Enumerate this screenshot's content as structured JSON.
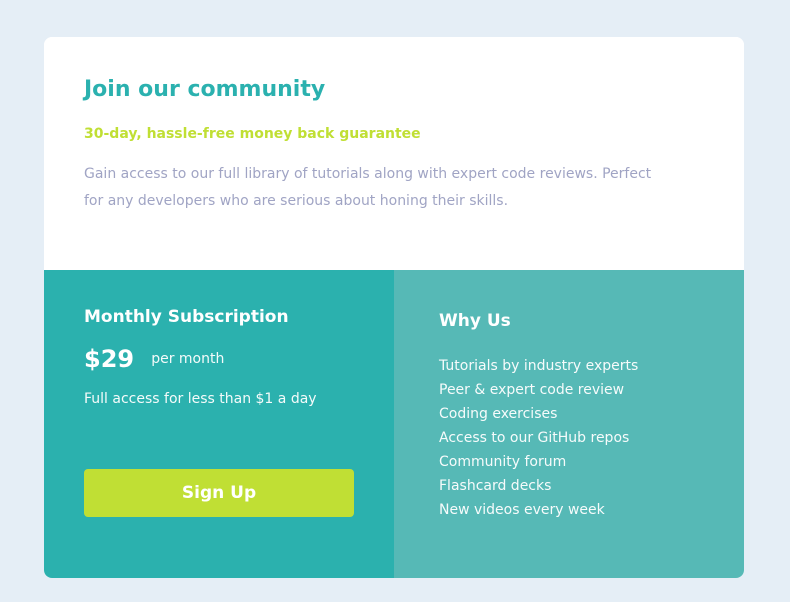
{
  "header": {
    "title": "Join our community",
    "subtitle": "30-day, hassle-free money back guarantee",
    "description": "Gain access to our full library of tutorials along with expert code reviews. Perfect for any developers who are serious about honing their skills."
  },
  "subscription": {
    "title": "Monthly Subscription",
    "price": "$29",
    "period": "per month",
    "note": "Full access for less than $1 a day",
    "button_label": "Sign Up"
  },
  "why_us": {
    "title": "Why Us",
    "items": [
      "Tutorials by industry experts",
      "Peer & expert code review",
      "Coding exercises",
      "Access to our GitHub repos",
      "Community forum",
      "Flashcard decks",
      "New videos every week"
    ]
  },
  "colors": {
    "page_background": "#e5eef6",
    "accent_cyan": "#2bb1af",
    "accent_lime": "#c0df34",
    "text_muted": "#a0a4c4",
    "panel_left": "#2bb1ae",
    "panel_right": "#56b9b6"
  }
}
